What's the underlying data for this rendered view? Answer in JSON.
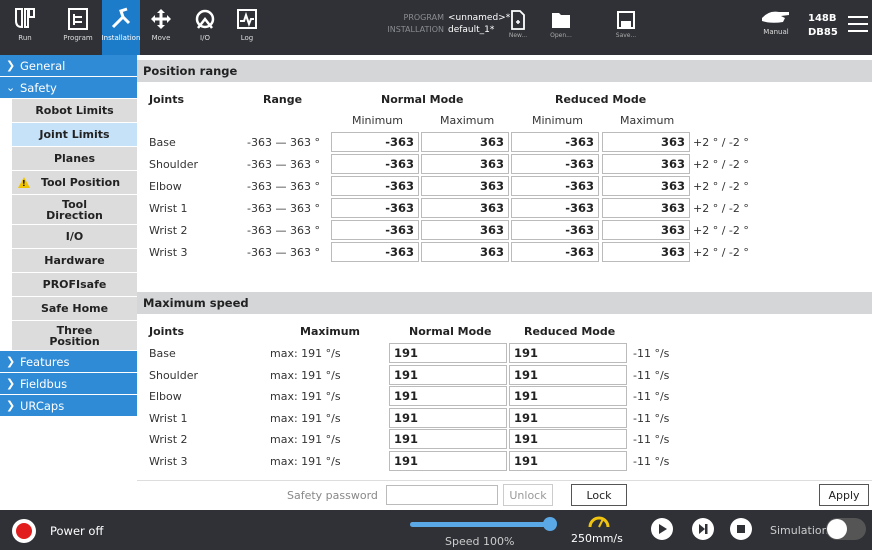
{
  "topbar": {
    "nav": [
      {
        "label": "Run",
        "icon": "ur-logo-icon"
      },
      {
        "label": "Program",
        "icon": "program-icon"
      },
      {
        "label": "Installation",
        "icon": "installation-icon"
      },
      {
        "label": "Move",
        "icon": "move-icon"
      },
      {
        "label": "I/O",
        "icon": "io-icon"
      },
      {
        "label": "Log",
        "icon": "log-icon"
      }
    ],
    "program_key": "PROGRAM",
    "program_val": "<unnamed>*",
    "installation_key": "INSTALLATION",
    "installation_val": "default_1*",
    "file": [
      {
        "label": "New...",
        "icon": "new-file-icon"
      },
      {
        "label": "Open...",
        "icon": "open-folder-icon"
      },
      {
        "label": "Save...",
        "icon": "save-icon"
      }
    ],
    "mode_label": "Manual",
    "serial_line1": "148B",
    "serial_line2": "DB85",
    "accent": "#1d7cc9"
  },
  "sidebar": {
    "general": "General",
    "safety": "Safety",
    "items": [
      "Robot Limits",
      "Joint Limits",
      "Planes",
      "Tool Position",
      "Tool Direction",
      "I/O",
      "Hardware",
      "PROFIsafe",
      "Safe Home",
      "Three Position"
    ],
    "features": "Features",
    "fieldbus": "Fieldbus",
    "urcaps": "URCaps"
  },
  "position_range": {
    "title": "Position range",
    "col_joints": "Joints",
    "col_range": "Range",
    "col_normal": "Normal Mode",
    "col_reduced": "Reduced Mode",
    "sub_min": "Minimum",
    "sub_max": "Maximum",
    "rows": [
      {
        "joint": "Base",
        "range": "-363 — 363 °",
        "nmin": "-363",
        "nmax": "363",
        "rmin": "-363",
        "rmax": "363",
        "tol": "+2 ° / -2 °"
      },
      {
        "joint": "Shoulder",
        "range": "-363 — 363 °",
        "nmin": "-363",
        "nmax": "363",
        "rmin": "-363",
        "rmax": "363",
        "tol": "+2 ° / -2 °"
      },
      {
        "joint": "Elbow",
        "range": "-363 — 363 °",
        "nmin": "-363",
        "nmax": "363",
        "rmin": "-363",
        "rmax": "363",
        "tol": "+2 ° / -2 °"
      },
      {
        "joint": "Wrist 1",
        "range": "-363 — 363 °",
        "nmin": "-363",
        "nmax": "363",
        "rmin": "-363",
        "rmax": "363",
        "tol": "+2 ° / -2 °"
      },
      {
        "joint": "Wrist 2",
        "range": "-363 — 363 °",
        "nmin": "-363",
        "nmax": "363",
        "rmin": "-363",
        "rmax": "363",
        "tol": "+2 ° / -2 °"
      },
      {
        "joint": "Wrist 3",
        "range": "-363 — 363 °",
        "nmin": "-363",
        "nmax": "363",
        "rmin": "-363",
        "rmax": "363",
        "tol": "+2 ° / -2 °"
      }
    ]
  },
  "max_speed": {
    "title": "Maximum speed",
    "col_joints": "Joints",
    "col_max": "Maximum",
    "col_normal": "Normal Mode",
    "col_reduced": "Reduced Mode",
    "rows": [
      {
        "joint": "Base",
        "max": "max: 191 °/s",
        "normal": "191",
        "reduced": "191",
        "tol": "-11 °/s"
      },
      {
        "joint": "Shoulder",
        "max": "max: 191 °/s",
        "normal": "191",
        "reduced": "191",
        "tol": "-11 °/s"
      },
      {
        "joint": "Elbow",
        "max": "max: 191 °/s",
        "normal": "191",
        "reduced": "191",
        "tol": "-11 °/s"
      },
      {
        "joint": "Wrist 1",
        "max": "max: 191 °/s",
        "normal": "191",
        "reduced": "191",
        "tol": "-11 °/s"
      },
      {
        "joint": "Wrist 2",
        "max": "max: 191 °/s",
        "normal": "191",
        "reduced": "191",
        "tol": "-11 °/s"
      },
      {
        "joint": "Wrist 3",
        "max": "max: 191 °/s",
        "normal": "191",
        "reduced": "191",
        "tol": "-11 °/s"
      }
    ]
  },
  "password": {
    "label": "Safety password",
    "unlock": "Unlock",
    "lock": "Lock",
    "apply": "Apply"
  },
  "bottombar": {
    "power": "Power off",
    "speed_label": "Speed 100%",
    "speed_fraction": 1.0,
    "tcp_speed": "250mm/s",
    "simulation": "Simulation",
    "power_color": "#e21d1d"
  }
}
